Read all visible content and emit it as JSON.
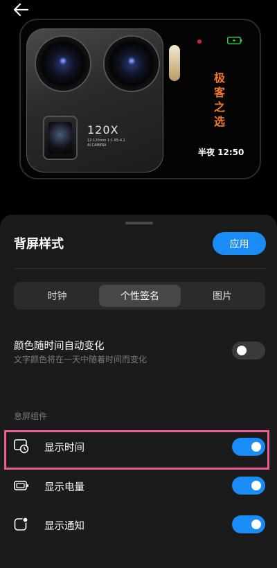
{
  "nav": {
    "back_icon": "arrow-left-icon"
  },
  "preview": {
    "camera_label": "120X",
    "camera_spec_line1": "12-120mm 1:1.95-4.1",
    "camera_spec_line2": "AI CAMERA",
    "signature_text": [
      "极",
      "客",
      "之",
      "选"
    ],
    "time_text": "半夜 12:50",
    "signature_color": "#f07a2b",
    "battery_color": "#2ecc40"
  },
  "sheet": {
    "title": "背屏样式",
    "apply_label": "应用",
    "tabs": [
      {
        "label": "时钟",
        "selected": false
      },
      {
        "label": "个性签名",
        "selected": true
      },
      {
        "label": "图片",
        "selected": false
      }
    ],
    "auto_color": {
      "title": "颜色随时间自动变化",
      "subtitle": "文字颜色将在一天中随着时间而变化",
      "enabled": false
    },
    "widgets_section_label": "息屏组件",
    "widgets": [
      {
        "icon": "clock-widget-icon",
        "label": "显示时间",
        "enabled": true
      },
      {
        "icon": "battery-icon",
        "label": "显示电量",
        "enabled": true
      },
      {
        "icon": "notification-icon",
        "label": "显示通知",
        "enabled": true
      }
    ],
    "accent_color": "#1a8cf5",
    "highlight_color": "#ef5d97"
  }
}
